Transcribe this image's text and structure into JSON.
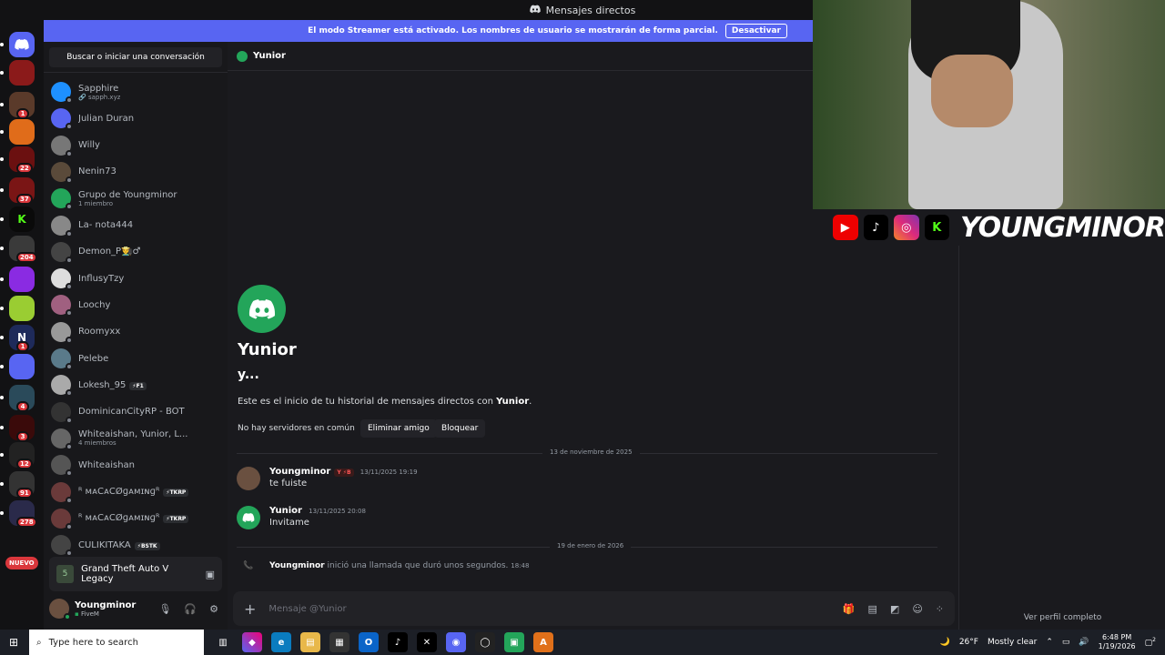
{
  "window": {
    "title": "Mensajes directos"
  },
  "streamer_banner": {
    "text": "El modo Streamer está activado. Los nombres de usuario se mostrarán de forma parcial.",
    "button": "Desactivar"
  },
  "rail": {
    "items": [
      {
        "icon": "discord-home-icon",
        "color": "#5865f2",
        "label": "",
        "badge": ""
      },
      {
        "icon": "server-icon",
        "color": "#8b1a1a",
        "label": "",
        "badge": ""
      },
      {
        "icon": "server-icon",
        "color": "#5a3a2a",
        "label": "",
        "badge": "1"
      },
      {
        "icon": "server-icon",
        "color": "#e06c1a",
        "label": "",
        "badge": ""
      },
      {
        "icon": "server-icon",
        "color": "#6b1010",
        "label": "",
        "badge": "22"
      },
      {
        "icon": "server-icon",
        "color": "#7a1515",
        "label": "",
        "badge": "37"
      },
      {
        "icon": "kick-icon",
        "color": "#0a0a0a",
        "label": "K",
        "badge": ""
      },
      {
        "icon": "server-icon",
        "color": "#3a3a3a",
        "label": "",
        "badge": "204"
      },
      {
        "icon": "server-icon",
        "color": "#8a2be2",
        "label": "",
        "badge": ""
      },
      {
        "icon": "server-icon",
        "color": "#9acd32",
        "label": "",
        "badge": ""
      },
      {
        "icon": "server-icon",
        "color": "#1e2a5a",
        "label": "N",
        "badge": "1"
      },
      {
        "icon": "server-icon",
        "color": "#5865f2",
        "label": "",
        "badge": ""
      },
      {
        "icon": "server-icon",
        "color": "#2a4a5a",
        "label": "",
        "badge": "4"
      },
      {
        "icon": "server-icon",
        "color": "#3a0a0a",
        "label": "",
        "badge": "3"
      },
      {
        "icon": "server-icon",
        "color": "#222",
        "label": "",
        "badge": "12"
      },
      {
        "icon": "server-icon",
        "color": "#333",
        "label": "",
        "badge": "91"
      },
      {
        "icon": "server-icon",
        "color": "#2a2a4a",
        "label": "",
        "badge": "278"
      }
    ],
    "nuevo": "NUEVO"
  },
  "dm_list": {
    "search_placeholder": "Buscar o iniciar una conversación",
    "items": [
      {
        "name": "Sapphire",
        "sub": "🔗 sapph.xyz",
        "color": "#1e90ff",
        "tag": ""
      },
      {
        "name": "Julian Duran",
        "sub": "",
        "color": "#5865f2",
        "tag": ""
      },
      {
        "name": "Willy",
        "sub": "",
        "color": "#777",
        "tag": ""
      },
      {
        "name": "Nenin73",
        "sub": "",
        "color": "#5a4a3a",
        "tag": ""
      },
      {
        "name": "Grupo de Youngminor",
        "sub": "1 miembro",
        "color": "#23a55a",
        "tag": ""
      },
      {
        "name": "La- nota444",
        "sub": "",
        "color": "#888",
        "tag": ""
      },
      {
        "name": "Demon_P👨‍🌾♂",
        "sub": "",
        "color": "#444",
        "tag": ""
      },
      {
        "name": "InflusyTzy",
        "sub": "",
        "color": "#ddd",
        "tag": ""
      },
      {
        "name": "Loochy",
        "sub": "",
        "color": "#a06080",
        "tag": ""
      },
      {
        "name": "Roomyxx",
        "sub": "",
        "color": "#999",
        "tag": ""
      },
      {
        "name": "Pelebe",
        "sub": "",
        "color": "#5a7a8a",
        "tag": ""
      },
      {
        "name": "Lokesh_95",
        "sub": "",
        "color": "#aaa",
        "tag": "⚡F1"
      },
      {
        "name": "DominicanCityRP - BOT",
        "sub": "",
        "color": "#333",
        "tag": ""
      },
      {
        "name": "Whiteaishan, Yunior, L...",
        "sub": "4 miembros",
        "color": "#666",
        "tag": ""
      },
      {
        "name": "Whiteaishan",
        "sub": "",
        "color": "#555",
        "tag": ""
      },
      {
        "name": "ᴿ ᴍᴀĈᴀĈØɡᴀᴍɪɴɡᴿ",
        "sub": "",
        "color": "#6a3a3a",
        "tag": "⚡TKRP"
      },
      {
        "name": "ᴿ ᴍᴀĈᴀĈØɡᴀᴍɪɴɡᴿ",
        "sub": "",
        "color": "#6a3a3a",
        "tag": "⚡TKRP"
      },
      {
        "name": "CULIKITAKA",
        "sub": "",
        "color": "#444",
        "tag": "⚡BSTK"
      }
    ],
    "activity": "Grand Theft Auto V Legacy",
    "user": {
      "name": "Youngminor",
      "status": "FiveM"
    }
  },
  "chat": {
    "header_name": "Yunior",
    "intro_name": "Yunior",
    "intro_sub": "y...",
    "intro_text_prefix": "Este es el inicio de tu historial de mensajes directos con ",
    "intro_text_name": "Yunior",
    "intro_text_suffix": ".",
    "no_servers": "No hay servidores en común",
    "btn_remove": "Eliminar amigo",
    "btn_block": "Bloquear",
    "date1": "13 de noviembre de 2025",
    "date2": "19 de enero de 2026",
    "messages": [
      {
        "author": "Youngminor",
        "badge": "Y ⚡B",
        "time": "13/11/2025 19:19",
        "text": "te fuiste",
        "color": "#6a5040"
      },
      {
        "author": "Yunior",
        "badge": "",
        "time": "13/11/2025 20:08",
        "text": "Invitame",
        "color": "#23a55a"
      }
    ],
    "call": {
      "author": "Youngminor",
      "text": "inició una llamada que duró unos segundos.",
      "time": "18:48"
    },
    "composer_placeholder": "Mensaje @Yunior"
  },
  "profile": {
    "view_full": "Ver perfil completo"
  },
  "overlay": {
    "channel": "YOUNGMINOR",
    "socials": [
      "youtube-icon",
      "tiktok-icon",
      "instagram-icon",
      "kick-icon"
    ]
  },
  "taskbar": {
    "search_placeholder": "Type here to search",
    "weather": "26°F",
    "weather_desc": "Mostly clear",
    "time": "6:48 PM",
    "date": "1/19/2026",
    "notif_badge": "2"
  }
}
